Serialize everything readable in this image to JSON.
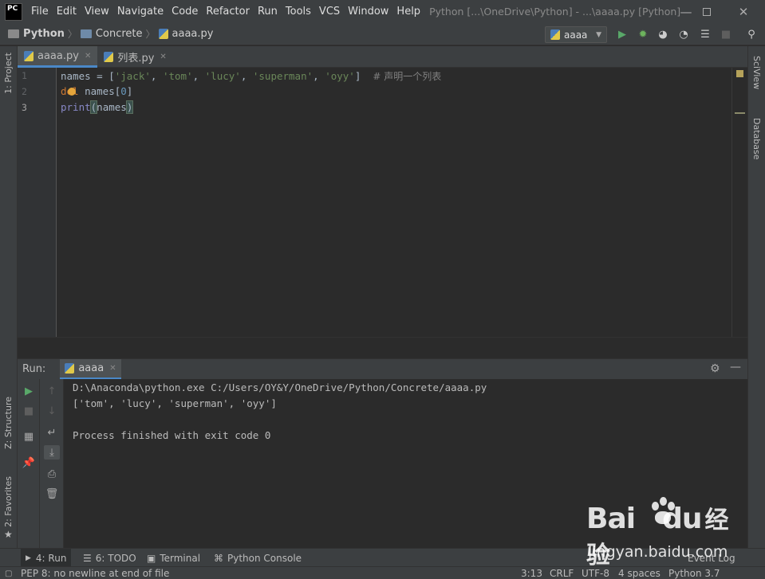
{
  "titlebar": {
    "logo": "PC",
    "menu": [
      "File",
      "Edit",
      "View",
      "Navigate",
      "Code",
      "Refactor",
      "Run",
      "Tools",
      "VCS",
      "Window",
      "Help"
    ],
    "window_title": "Python [...\\OneDrive\\Python] - ...\\aaaa.py [Python]"
  },
  "navbar": {
    "crumbs": [
      "Python",
      "Concrete",
      "aaaa.py"
    ],
    "run_config": "aaaa"
  },
  "left_strip": {
    "project": "1: Project",
    "structure": "Z: Structure",
    "favorites": "2: Favorites"
  },
  "right_strip": {
    "sciview": "SciView",
    "database": "Database"
  },
  "editor": {
    "tabs": [
      {
        "label": "aaaa.py"
      },
      {
        "label": "列表.py"
      }
    ],
    "line_numbers": [
      "1",
      "2",
      "3"
    ],
    "lines": [
      {
        "a": "names = [",
        "s1": "'jack'",
        "c1": ", ",
        "s2": "'tom'",
        "c2": ", ",
        "s3": "'lucy'",
        "c3": ", ",
        "s4": "'superman'",
        "c4": ", ",
        "s5": "'oyy'",
        "end": "]  ",
        "comment": "# 声明一个列表"
      },
      {
        "kw": "del",
        "rest": " names[",
        "num": "0",
        "close": "]"
      },
      {
        "fn": "print",
        "open": "(",
        "arg": "names",
        "close": ")"
      }
    ]
  },
  "run_panel": {
    "label": "Run:",
    "tab": "aaaa",
    "output": [
      "D:\\Anaconda\\python.exe C:/Users/OY&Y/OneDrive/Python/Concrete/aaaa.py",
      "['tom', 'lucy', 'superman', 'oyy']",
      "",
      "Process finished with exit code 0"
    ]
  },
  "bottom_tabs": {
    "run": "4: Run",
    "todo": "6: TODO",
    "terminal": "Terminal",
    "python_console": "Python Console",
    "event_log": "Event Log"
  },
  "statusbar": {
    "message": "PEP 8: no newline at end of file",
    "position": "3:13",
    "line_sep": "CRLF",
    "encoding": "UTF-8",
    "indent": "4 spaces",
    "interpreter": "Python 3.7"
  },
  "watermark": {
    "brand": "Bai",
    "brand2": "du",
    "cn": "经验",
    "url": "jingyan.baidu.com"
  },
  "colors": {
    "accent": "#4a88c7",
    "run_green": "#59a869",
    "debug_green": "#6db35d"
  }
}
